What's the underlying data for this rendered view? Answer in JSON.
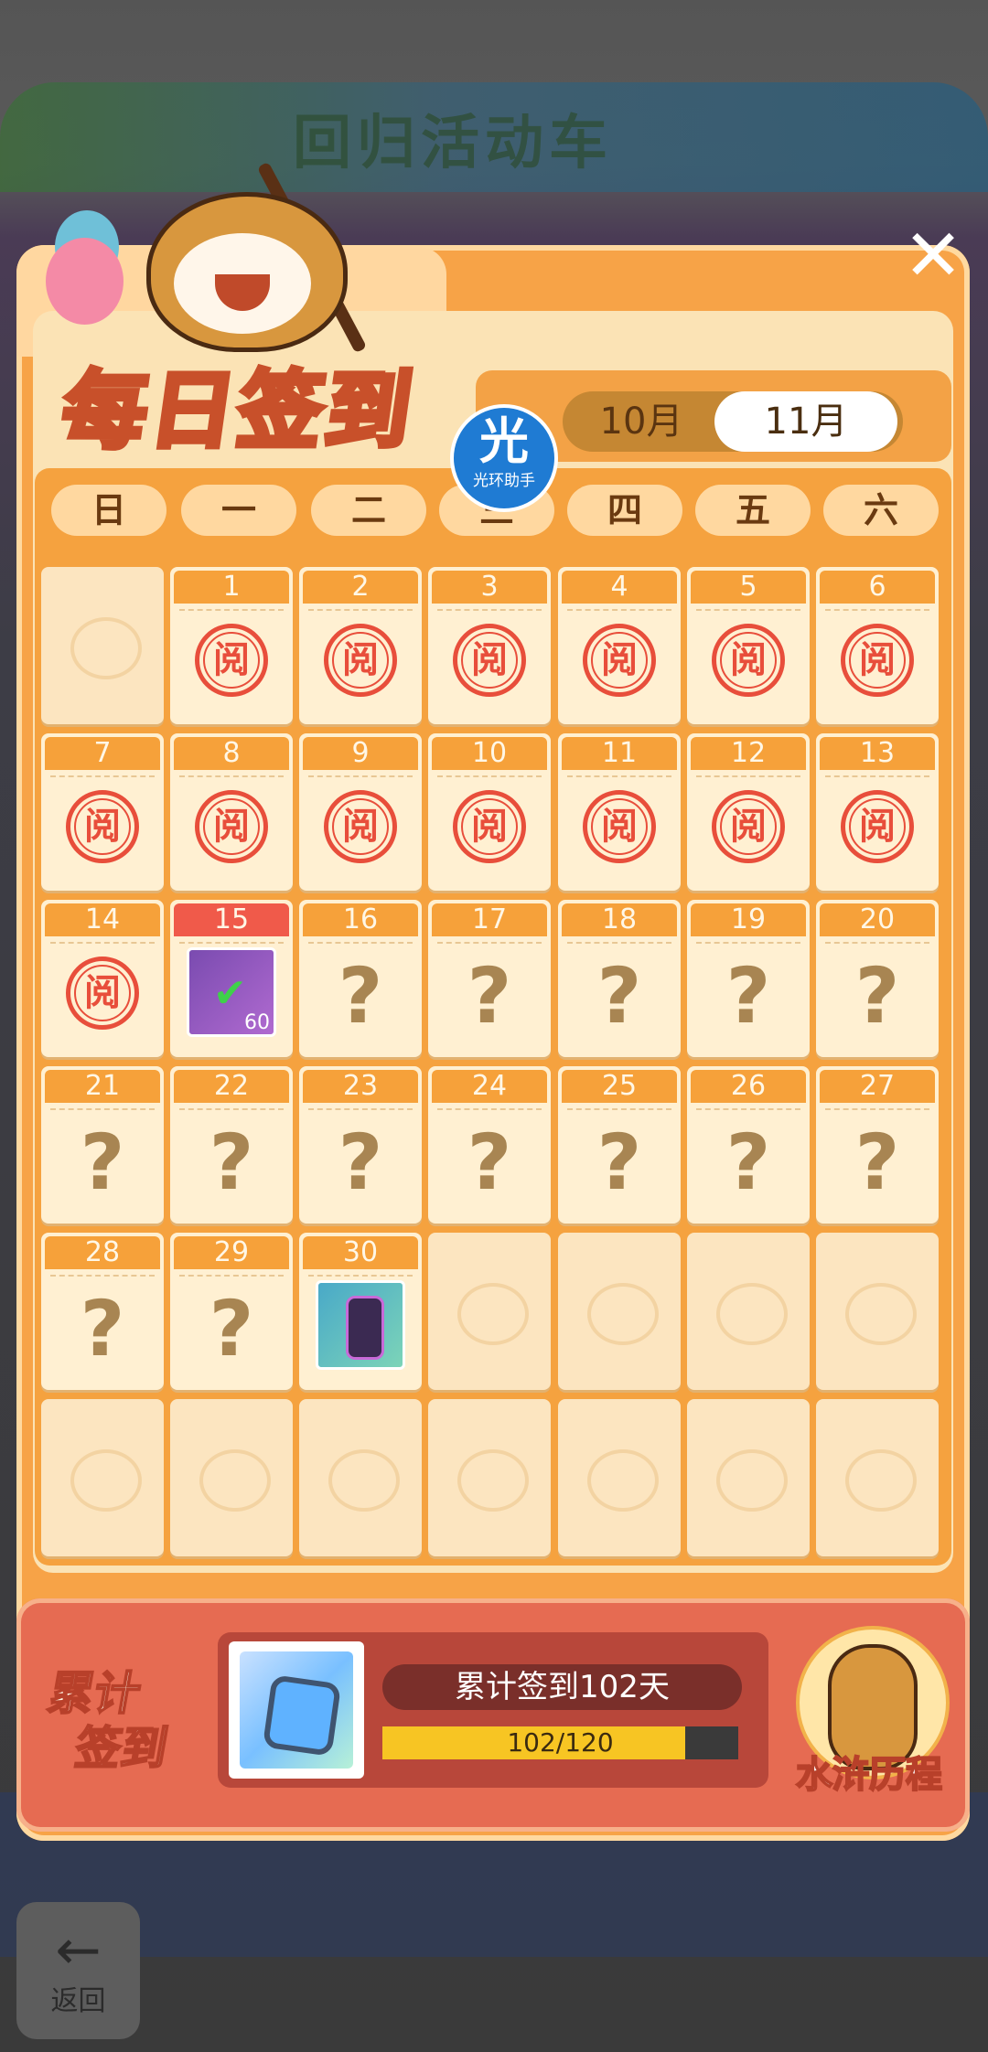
{
  "background": {
    "banner_title": "回归活动车",
    "back_label": "返回"
  },
  "panel": {
    "title": "每日签到",
    "months": [
      "10月",
      "11月"
    ],
    "selected_month": "11月",
    "watermark": {
      "big": "光",
      "small": "光环助手"
    },
    "weekdays": [
      "日",
      "一",
      "二",
      "三",
      "四",
      "五",
      "六"
    ]
  },
  "calendar": {
    "cells": [
      {
        "day": "",
        "state": "empty"
      },
      {
        "day": "1",
        "state": "signed",
        "stamp": "阅"
      },
      {
        "day": "2",
        "state": "signed",
        "stamp": "阅"
      },
      {
        "day": "3",
        "state": "signed",
        "stamp": "阅"
      },
      {
        "day": "4",
        "state": "signed",
        "stamp": "阅"
      },
      {
        "day": "5",
        "state": "signed",
        "stamp": "阅"
      },
      {
        "day": "6",
        "state": "signed",
        "stamp": "阅"
      },
      {
        "day": "7",
        "state": "signed",
        "stamp": "阅"
      },
      {
        "day": "8",
        "state": "signed",
        "stamp": "阅"
      },
      {
        "day": "9",
        "state": "signed",
        "stamp": "阅"
      },
      {
        "day": "10",
        "state": "signed",
        "stamp": "阅"
      },
      {
        "day": "11",
        "state": "signed",
        "stamp": "阅"
      },
      {
        "day": "12",
        "state": "signed",
        "stamp": "阅"
      },
      {
        "day": "13",
        "state": "signed",
        "stamp": "阅"
      },
      {
        "day": "14",
        "state": "signed",
        "stamp": "阅"
      },
      {
        "day": "15",
        "state": "today",
        "reward": "ticket",
        "count": "60"
      },
      {
        "day": "16",
        "state": "unknown",
        "mark": "?"
      },
      {
        "day": "17",
        "state": "unknown",
        "mark": "?"
      },
      {
        "day": "18",
        "state": "unknown",
        "mark": "?"
      },
      {
        "day": "19",
        "state": "unknown",
        "mark": "?"
      },
      {
        "day": "20",
        "state": "unknown",
        "mark": "?"
      },
      {
        "day": "21",
        "state": "unknown",
        "mark": "?"
      },
      {
        "day": "22",
        "state": "unknown",
        "mark": "?"
      },
      {
        "day": "23",
        "state": "unknown",
        "mark": "?"
      },
      {
        "day": "24",
        "state": "unknown",
        "mark": "?"
      },
      {
        "day": "25",
        "state": "unknown",
        "mark": "?"
      },
      {
        "day": "26",
        "state": "unknown",
        "mark": "?"
      },
      {
        "day": "27",
        "state": "unknown",
        "mark": "?"
      },
      {
        "day": "28",
        "state": "unknown",
        "mark": "?"
      },
      {
        "day": "29",
        "state": "unknown",
        "mark": "?"
      },
      {
        "day": "30",
        "state": "reward",
        "reward": "capsule"
      },
      {
        "day": "",
        "state": "empty"
      },
      {
        "day": "",
        "state": "empty"
      },
      {
        "day": "",
        "state": "empty"
      },
      {
        "day": "",
        "state": "empty"
      },
      {
        "day": "",
        "state": "empty"
      },
      {
        "day": "",
        "state": "empty"
      },
      {
        "day": "",
        "state": "empty"
      },
      {
        "day": "",
        "state": "empty"
      },
      {
        "day": "",
        "state": "empty"
      },
      {
        "day": "",
        "state": "empty"
      },
      {
        "day": "",
        "state": "empty"
      }
    ]
  },
  "cumulative": {
    "label_line1": "累计",
    "label_line2": "签到",
    "days_text": "累计签到102天",
    "progress_text": "102/120",
    "progress_value": 102,
    "progress_max": 120,
    "journey_label": "水浒历程"
  },
  "colors": {
    "accent": "#f6a13a",
    "stamp": "#e84e3b",
    "today": "#f05a4a",
    "progress": "#f7c523"
  }
}
